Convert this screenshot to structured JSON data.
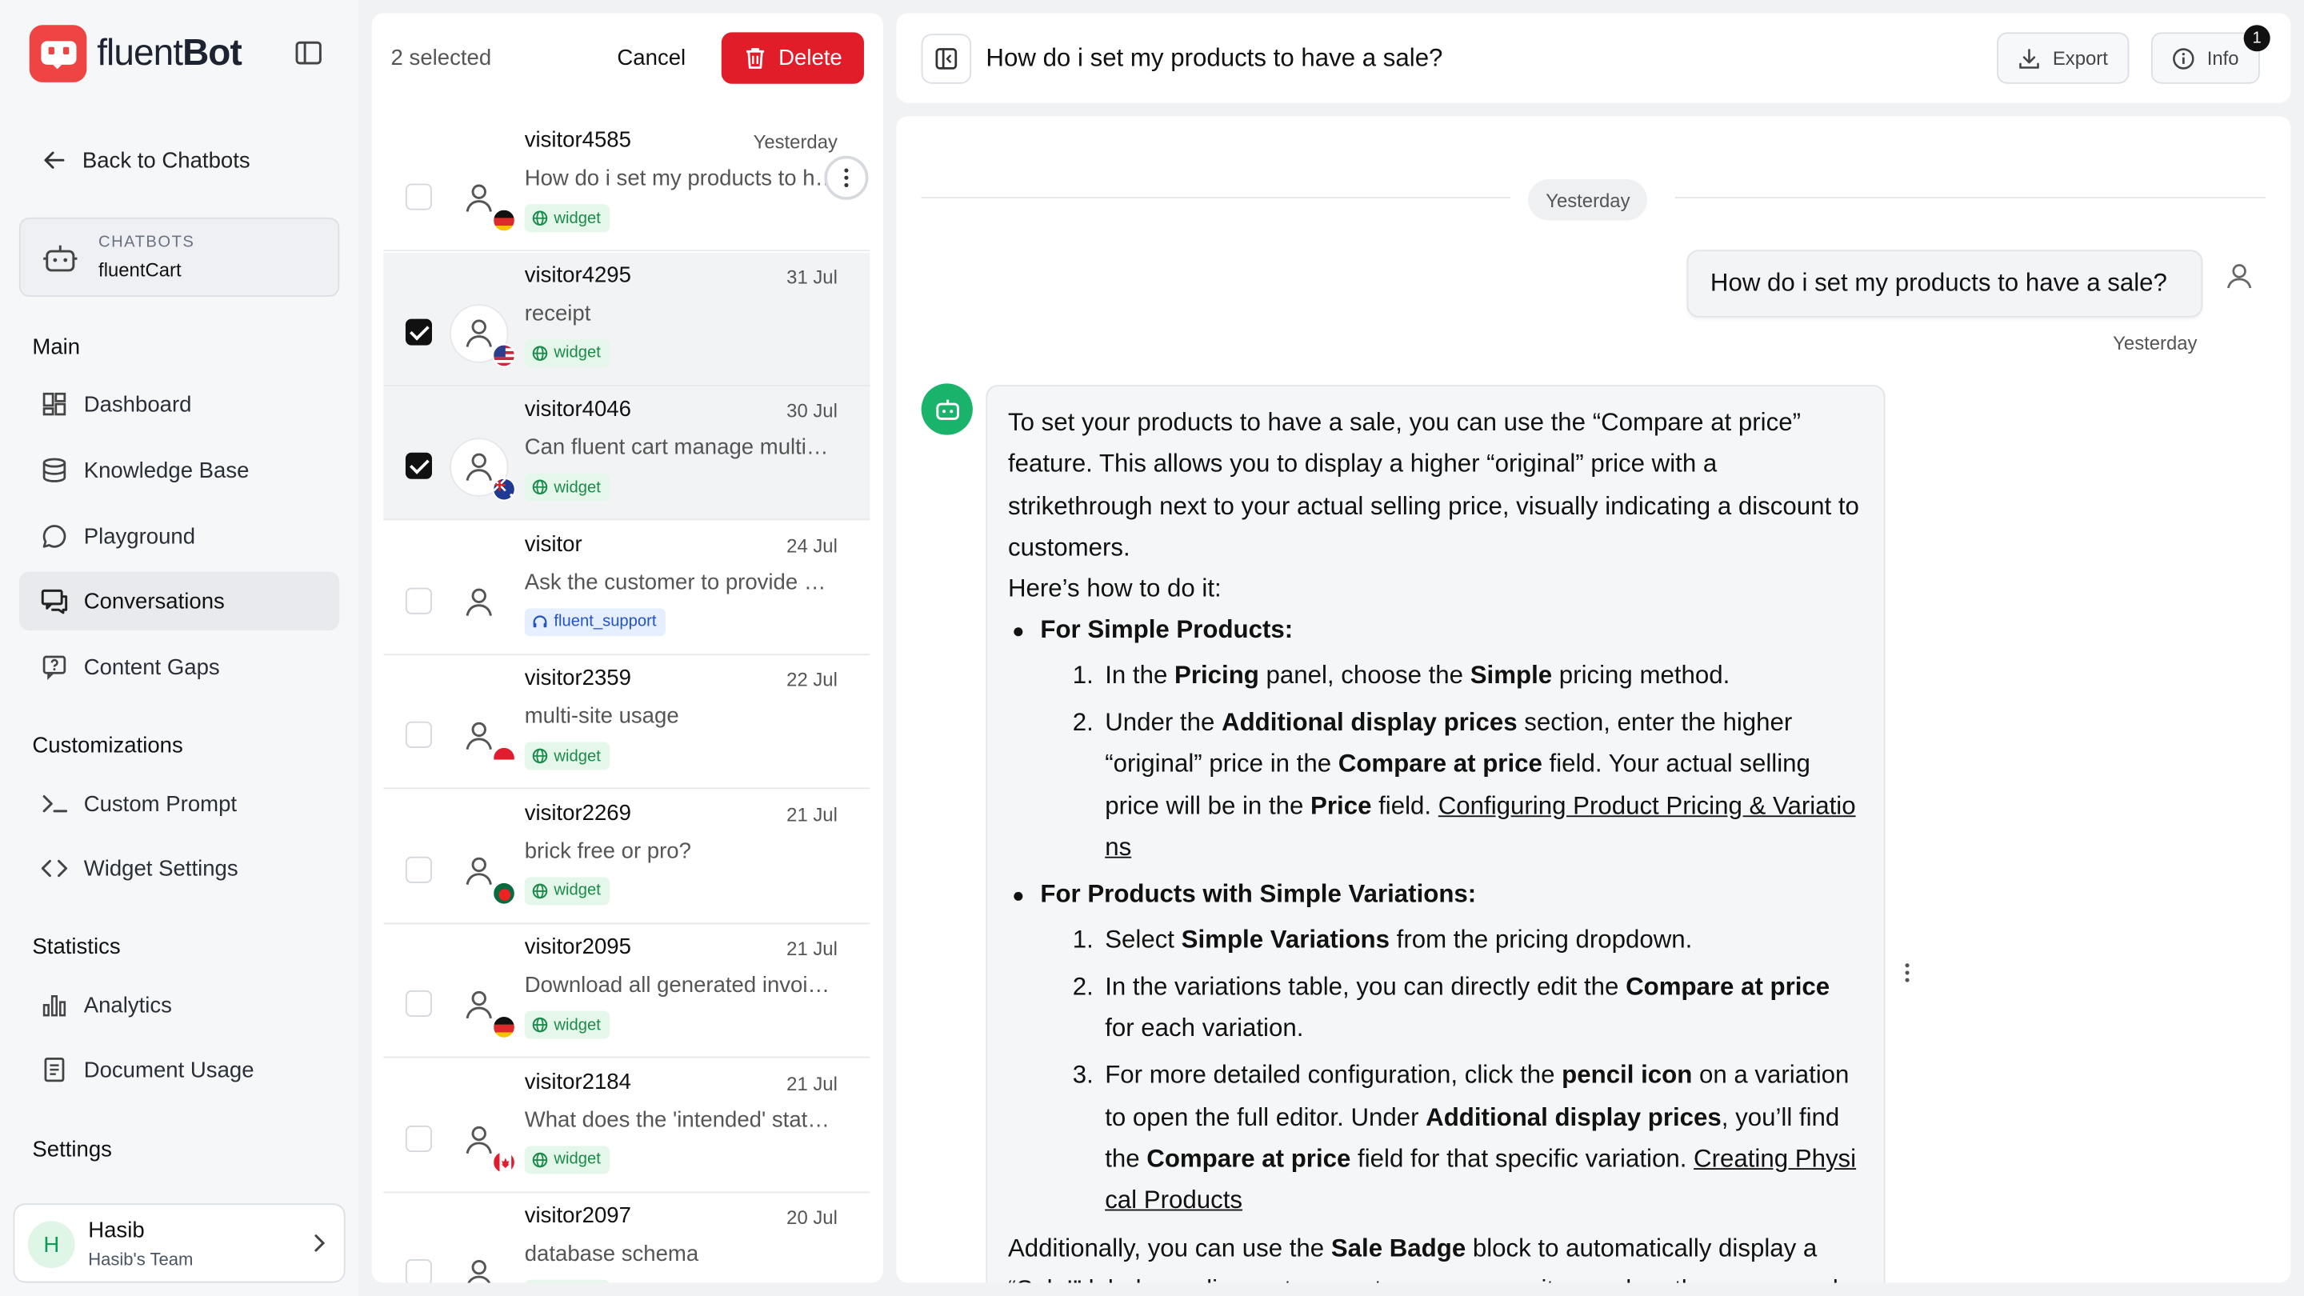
{
  "brand": {
    "name_light": "fluent",
    "name_bold": "Bot"
  },
  "sidebar": {
    "back_label": "Back to Chatbots",
    "bot_overline": "CHATBOTS",
    "bot_name": "fluentCart",
    "sections": [
      {
        "title": "Main",
        "items": [
          "Dashboard",
          "Knowledge Base",
          "Playground",
          "Conversations",
          "Content Gaps"
        ]
      },
      {
        "title": "Customizations",
        "items": [
          "Custom Prompt",
          "Widget Settings"
        ]
      },
      {
        "title": "Statistics",
        "items": [
          "Analytics",
          "Document Usage"
        ]
      },
      {
        "title": "Settings",
        "items": []
      }
    ],
    "active_item": "Conversations",
    "user": {
      "initial": "H",
      "name": "Hasib",
      "team": "Hasib's Team"
    }
  },
  "list": {
    "selected_label": "2 selected",
    "cancel_label": "Cancel",
    "delete_label": "Delete",
    "conversations": [
      {
        "name": "visitor4585",
        "date": "Yesterday",
        "message": "How do i set my products to have a sale?",
        "tag": "widget",
        "flag": "de",
        "checked": false
      },
      {
        "name": "visitor4295",
        "date": "31 Jul",
        "message": "receipt",
        "tag": "widget",
        "flag": "us",
        "checked": true
      },
      {
        "name": "visitor4046",
        "date": "30 Jul",
        "message": "Can fluent cart manage multiple stores?",
        "tag": "widget",
        "flag": "au",
        "checked": true
      },
      {
        "name": "visitor",
        "date": "24 Jul",
        "message": "Ask the customer to provide more details",
        "tag": "fluent_support",
        "flag": "",
        "checked": false
      },
      {
        "name": "visitor2359",
        "date": "22 Jul",
        "message": "multi-site usage",
        "tag": "widget",
        "flag": "sg",
        "checked": false
      },
      {
        "name": "visitor2269",
        "date": "21 Jul",
        "message": "brick free or pro?",
        "tag": "widget",
        "flag": "bd",
        "checked": false
      },
      {
        "name": "visitor2095",
        "date": "21 Jul",
        "message": "Download all generated invoices",
        "tag": "widget",
        "flag": "de",
        "checked": false
      },
      {
        "name": "visitor2184",
        "date": "21 Jul",
        "message": "What does the 'intended' status mean?",
        "tag": "widget",
        "flag": "ca",
        "checked": false
      },
      {
        "name": "visitor2097",
        "date": "20 Jul",
        "message": "database schema",
        "tag": "widget",
        "flag": "bd",
        "checked": false
      }
    ]
  },
  "chat": {
    "title": "How do i set my products to have a sale?",
    "export_label": "Export",
    "info_label": "Info",
    "info_badge": "1",
    "date_divider": "Yesterday",
    "user_message": "How do i set my products to have a sale?",
    "user_time": "Yesterday",
    "bot": {
      "intro": "To set your products to have a sale, you can use the “Compare at price” feature. This allows you to display a higher “original” price with a strikethrough next to your actual selling price, visually indicating a discount to customers.",
      "howto": "Here’s how to do it:",
      "b1_title": "For Simple Products:",
      "b1_s1_a": "In the ",
      "b1_s1_b": "Pricing",
      "b1_s1_c": " panel, choose the ",
      "b1_s1_d": "Simple",
      "b1_s1_e": " pricing method.",
      "b1_s2_a": "Under the ",
      "b1_s2_b": "Additional display prices",
      "b1_s2_c": " section, enter the higher “original” price in the ",
      "b1_s2_d": "Compare at price",
      "b1_s2_e": " field. Your actual selling price will be in the ",
      "b1_s2_f": "Price",
      "b1_s2_g": " field. ",
      "b1_s2_link": "Configuring Product Pricing & Variations",
      "b2_title": "For Products with Simple Variations:",
      "b2_s1_a": "Select ",
      "b2_s1_b": "Simple Variations",
      "b2_s1_c": " from the pricing dropdown.",
      "b2_s2_a": "In the variations table, you can directly edit the ",
      "b2_s2_b": "Compare at price",
      "b2_s2_c": " for each variation.",
      "b2_s3_a": "For more detailed configuration, click the ",
      "b2_s3_b": "pencil icon",
      "b2_s3_c": " on a variation to open the full editor. Under ",
      "b2_s3_d": "Additional display prices",
      "b2_s3_e": ", you’ll find the ",
      "b2_s3_f": "Compare at price",
      "b2_s3_g": " field for that specific variation. ",
      "b2_s3_link": "Creating Physical Products",
      "outro_a": "Additionally, you can use the ",
      "outro_b": "Sale Badge",
      "outro_c": " block to automatically display a “Sale!” label or a discount percentage over your items when they are on sale."
    }
  },
  "colors": {
    "brand_red": "#ef4444",
    "delete_red": "#e11d2a",
    "bot_green": "#19b36b",
    "widget_green": "#1c8a4a",
    "support_blue": "#2453c7"
  }
}
